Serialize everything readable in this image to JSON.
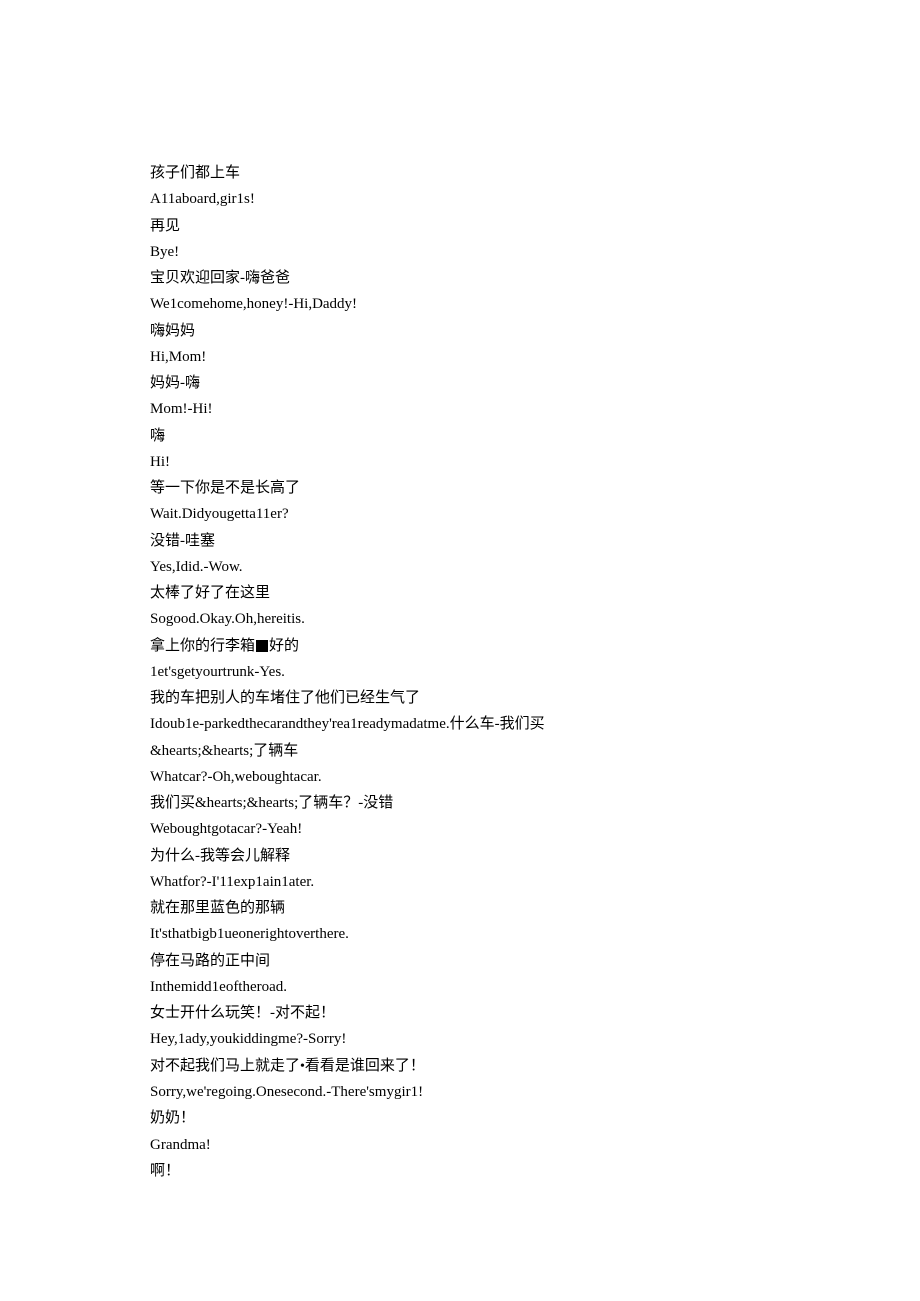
{
  "lines": [
    "孩子们都上车",
    "A11aboard,gir1s!",
    "再见",
    "Bye!",
    "宝贝欢迎回家-嗨爸爸",
    "We1comehome,honey!-Hi,Daddy!",
    "嗨妈妈",
    "Hi,Mom!",
    "妈妈-嗨",
    "Mom!-Hi!",
    "嗨",
    "Hi!",
    "等一下你是不是长高了",
    "Wait.Didyougetta11er?",
    "没错-哇塞",
    "Yes,Idid.-Wow.",
    "太棒了好了在这里",
    "Sogood.Okay.Oh,hereitis.",
    [
      "拿上你的行李箱",
      "■",
      "好的"
    ],
    "1et'sgetyourtrunk-Yes.",
    "我的车把别人的车堵住了他们已经生气了",
    "Idoub1e-parkedthecarandthey'rea1readymadatme.什么车-我们买",
    "&hearts;&hearts;了辆车",
    "Whatcar?-Oh,weboughtacar.",
    "我们买&hearts;&hearts;了辆车？-没错",
    "Weboughtgotacar?-Yeah!",
    "为什么-我等会儿解释",
    "Whatfor?-I'11exp1ain1ater.",
    "就在那里蓝色的那辆",
    "It'sthatbigb1ueonerightoverthere.",
    "停在马路的正中间",
    "Inthemidd1eoftheroad.",
    "女士开什么玩笑！-对不起！",
    "Hey,1ady,youkiddingme?-Sorry!",
    [
      "对不起我们马上就走了",
      "•",
      "看看是谁回来了！"
    ],
    "Sorry,we'regoing.Onesecond.-There'smygir1!",
    "奶奶！",
    "Grandma!",
    "啊！"
  ]
}
